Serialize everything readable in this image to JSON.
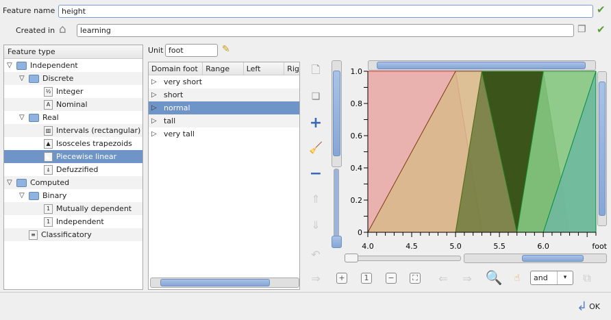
{
  "feature_name": {
    "label": "Feature name",
    "value": "height"
  },
  "created_in": {
    "label": "Created in",
    "value": "learning"
  },
  "tree": {
    "header": "Feature type",
    "items": [
      {
        "label": "Independent",
        "level": 0,
        "type": "folder"
      },
      {
        "label": "Discrete",
        "level": 1,
        "type": "folder"
      },
      {
        "label": "Integer",
        "level": 2,
        "type": "leaf",
        "icon": "½"
      },
      {
        "label": "Nominal",
        "level": 2,
        "type": "leaf",
        "icon": "A"
      },
      {
        "label": "Real",
        "level": 1,
        "type": "folder"
      },
      {
        "label": "Intervals (rectangular)",
        "level": 2,
        "type": "leaf",
        "icon": "▥"
      },
      {
        "label": "Isosceles trapezoids",
        "level": 2,
        "type": "leaf",
        "icon": "▲"
      },
      {
        "label": "Piecewise linear",
        "level": 2,
        "type": "leaf",
        "icon": "◣",
        "selected": true
      },
      {
        "label": "Defuzzified",
        "level": 2,
        "type": "leaf",
        "icon": "⍋"
      },
      {
        "label": "Computed",
        "level": 0,
        "type": "folder"
      },
      {
        "label": "Binary",
        "level": 1,
        "type": "folder"
      },
      {
        "label": "Mutually dependent",
        "level": 2,
        "type": "leaf",
        "icon": "1"
      },
      {
        "label": "Independent",
        "level": 2,
        "type": "leaf",
        "icon": "1"
      },
      {
        "label": "Classificatory",
        "level": 1,
        "type": "leaf",
        "icon": "≡"
      }
    ]
  },
  "unit": {
    "label": "Unit",
    "value": "foot"
  },
  "table": {
    "columns": [
      "Domain foot",
      "Range",
      "Left",
      "Rig"
    ],
    "rows": [
      "very short",
      "short",
      "normal",
      "tall",
      "very tall"
    ],
    "selected": "normal"
  },
  "combine": {
    "value": "and"
  },
  "ok_label": "OK",
  "chart_data": {
    "type": "area",
    "xlabel": "foot",
    "xlim": [
      4.0,
      6.6
    ],
    "ylim": [
      0,
      1
    ],
    "x_ticks": [
      "4.0",
      "4.5",
      "5.0",
      "5.5",
      "6.0"
    ],
    "y_ticks": [
      "0",
      "0.2",
      "0.4",
      "0.6",
      "0.8",
      "1.0"
    ],
    "series": [
      {
        "points": [
          [
            4,
            0
          ],
          [
            4,
            1
          ],
          [
            5,
            1
          ],
          [
            5.3,
            0
          ]
        ],
        "color": "#e6a8a8",
        "edge": "#d03030"
      },
      {
        "points": [
          [
            4,
            0
          ],
          [
            5,
            1
          ],
          [
            5.3,
            1
          ],
          [
            5.7,
            0
          ]
        ],
        "color": "#d8b88a",
        "edge": "#7a3a10"
      },
      {
        "points": [
          [
            5,
            0
          ],
          [
            5.3,
            1
          ],
          [
            6,
            1
          ],
          [
            6.3,
            0
          ]
        ],
        "color": "#6f7a40",
        "edge": "#4a6a10"
      },
      {
        "points": [
          [
            5.3,
            1
          ],
          [
            6,
            1
          ],
          [
            5.7,
            0
          ]
        ],
        "color": "#2e4a0e",
        "edge": "#1f7a1f"
      },
      {
        "points": [
          [
            5.7,
            0
          ],
          [
            6,
            1
          ],
          [
            6.6,
            1
          ],
          [
            6.6,
            0
          ]
        ],
        "color": "#7ec67e",
        "edge": "#1a8a2a"
      },
      {
        "points": [
          [
            6,
            0
          ],
          [
            6.6,
            1
          ],
          [
            6.6,
            0
          ]
        ],
        "color": "#6fb8a0",
        "edge": "#008a40"
      }
    ]
  }
}
